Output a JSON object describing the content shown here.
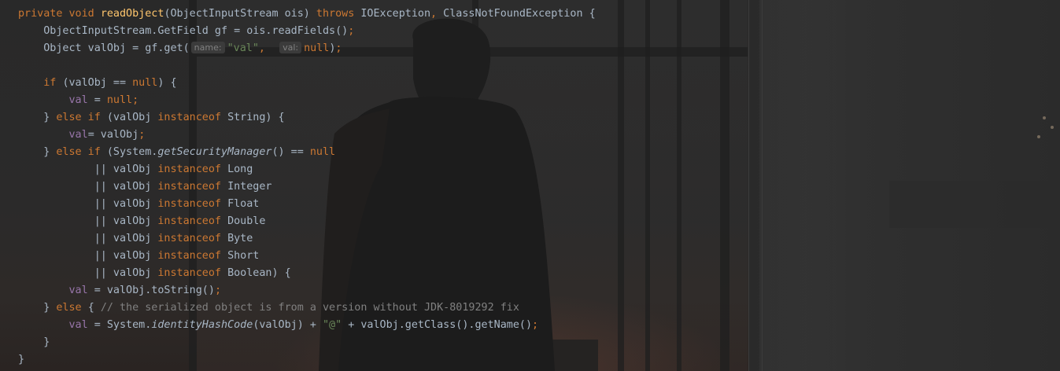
{
  "editor": {
    "language": "java",
    "lines": [
      [
        [
          "kw",
          "private void "
        ],
        [
          "fn",
          "readObject"
        ],
        [
          "plain",
          "(ObjectInputStream ois) "
        ],
        [
          "kw",
          "throws "
        ],
        [
          "plain",
          "IOException"
        ],
        [
          "kw",
          ", "
        ],
        [
          "plain",
          "ClassNotFoundException {"
        ]
      ],
      [
        [
          "plain",
          "    ObjectInputStream.GetField gf = ois.readFields()"
        ],
        [
          "kw",
          ";"
        ]
      ],
      [
        [
          "plain",
          "    Object valObj = gf.get("
        ],
        [
          "hint",
          "name:"
        ],
        [
          "str",
          "\"val\""
        ],
        [
          "kw",
          ",  "
        ],
        [
          "hint",
          "val:"
        ],
        [
          "kw",
          "null"
        ],
        [
          "plain",
          ")"
        ],
        [
          "kw",
          ";"
        ]
      ],
      [],
      [
        [
          "kw",
          "    if "
        ],
        [
          "plain",
          "(valObj == "
        ],
        [
          "kw",
          "null"
        ],
        [
          "plain",
          ") {"
        ]
      ],
      [
        [
          "fld",
          "        val "
        ],
        [
          "plain",
          "= "
        ],
        [
          "kw",
          "null;"
        ]
      ],
      [
        [
          "plain",
          "    } "
        ],
        [
          "kw",
          "else if "
        ],
        [
          "plain",
          "(valObj "
        ],
        [
          "kw",
          "instanceof "
        ],
        [
          "plain",
          "String) {"
        ]
      ],
      [
        [
          "fld",
          "        val"
        ],
        [
          "plain",
          "= valObj"
        ],
        [
          "kw",
          ";"
        ]
      ],
      [
        [
          "plain",
          "    } "
        ],
        [
          "kw",
          "else if "
        ],
        [
          "plain",
          "(System."
        ],
        [
          "ital",
          "getSecurityManager"
        ],
        [
          "plain",
          "() == "
        ],
        [
          "kw",
          "null"
        ]
      ],
      [
        [
          "plain",
          "            || valObj "
        ],
        [
          "kw",
          "instanceof "
        ],
        [
          "plain",
          "Long"
        ]
      ],
      [
        [
          "plain",
          "            || valObj "
        ],
        [
          "kw",
          "instanceof "
        ],
        [
          "plain",
          "Integer"
        ]
      ],
      [
        [
          "plain",
          "            || valObj "
        ],
        [
          "kw",
          "instanceof "
        ],
        [
          "plain",
          "Float"
        ]
      ],
      [
        [
          "plain",
          "            || valObj "
        ],
        [
          "kw",
          "instanceof "
        ],
        [
          "plain",
          "Double"
        ]
      ],
      [
        [
          "plain",
          "            || valObj "
        ],
        [
          "kw",
          "instanceof "
        ],
        [
          "plain",
          "Byte"
        ]
      ],
      [
        [
          "plain",
          "            || valObj "
        ],
        [
          "kw",
          "instanceof "
        ],
        [
          "plain",
          "Short"
        ]
      ],
      [
        [
          "plain",
          "            || valObj "
        ],
        [
          "kw",
          "instanceof "
        ],
        [
          "plain",
          "Boolean) {"
        ]
      ],
      [
        [
          "fld",
          "        val "
        ],
        [
          "plain",
          "= valObj.toString()"
        ],
        [
          "kw",
          ";"
        ]
      ],
      [
        [
          "plain",
          "    } "
        ],
        [
          "kw",
          "else "
        ],
        [
          "plain",
          "{ "
        ],
        [
          "cmt",
          "// the serialized object is from a version without JDK-8019292 fix"
        ]
      ],
      [
        [
          "fld",
          "        val "
        ],
        [
          "plain",
          "= System."
        ],
        [
          "ital",
          "identityHashCode"
        ],
        [
          "plain",
          "(valObj) + "
        ],
        [
          "str",
          "\"@\" "
        ],
        [
          "plain",
          "+ valObj.getClass().getName()"
        ],
        [
          "kw",
          ";"
        ]
      ],
      [
        [
          "plain",
          "    }"
        ]
      ],
      [
        [
          "plain",
          "}"
        ]
      ]
    ]
  },
  "colors": {
    "background": "#262626",
    "keyword": "#cc7832",
    "function": "#ffc66d",
    "field": "#9876aa",
    "string": "#6a8759",
    "comment": "#808080",
    "text": "#a9b7c6"
  }
}
